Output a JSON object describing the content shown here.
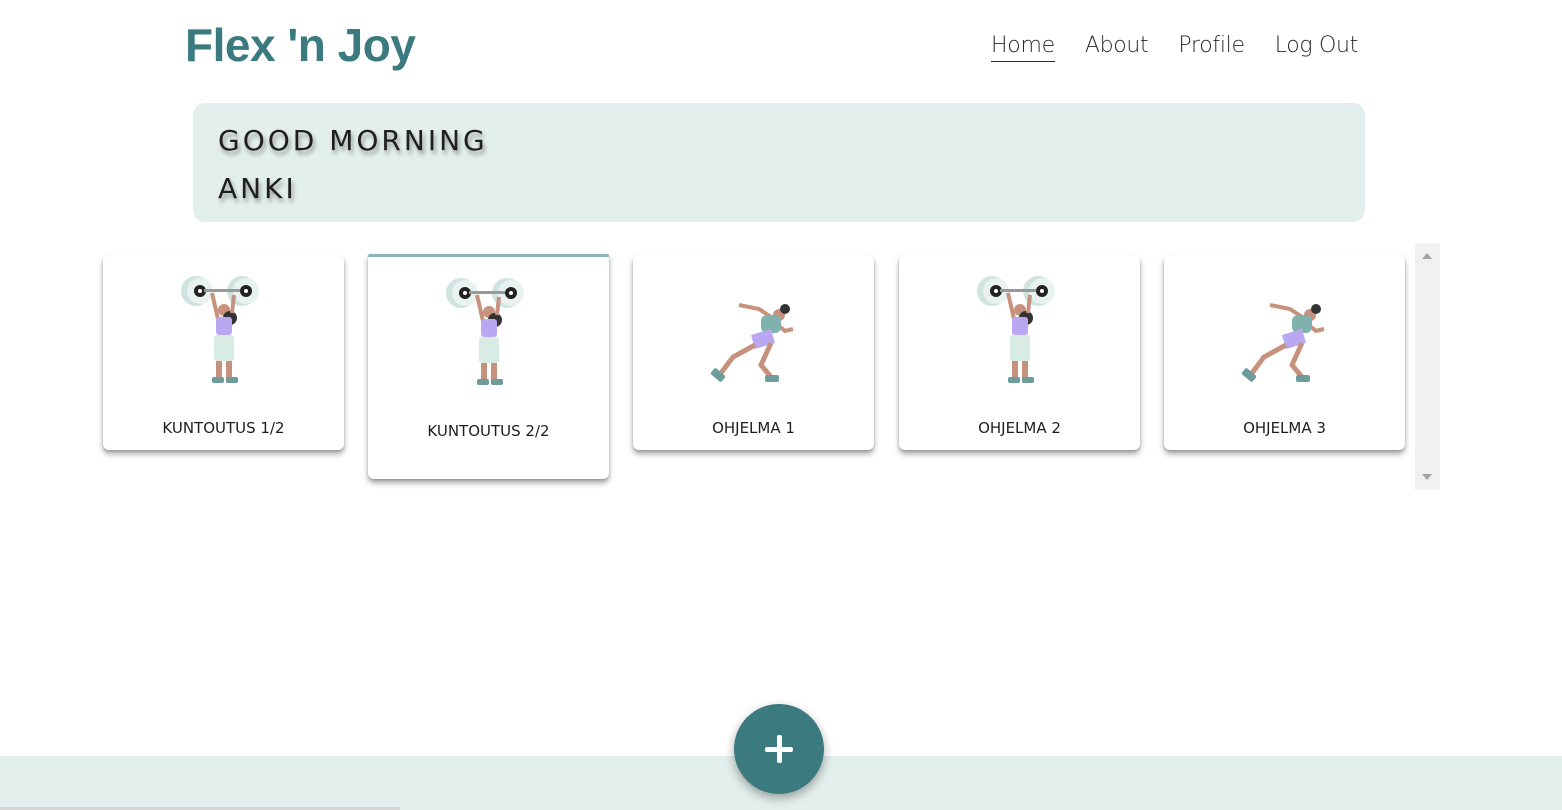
{
  "brand": {
    "title": "Flex 'n Joy"
  },
  "nav": {
    "items": [
      {
        "label": "Home",
        "active": true
      },
      {
        "label": "About",
        "active": false
      },
      {
        "label": "Profile",
        "active": false
      },
      {
        "label": "Log Out",
        "active": false
      }
    ]
  },
  "greeting": {
    "line1": "GOOD MORNING",
    "line2": "ANKI"
  },
  "cards": [
    {
      "label": "KUNTOUTUS 1/2",
      "icon": "weightlifter-icon"
    },
    {
      "label": "KUNTOUTUS 2/2",
      "icon": "weightlifter-icon",
      "selected": true
    },
    {
      "label": "OHJELMA 1",
      "icon": "runner-icon"
    },
    {
      "label": "OHJELMA 2",
      "icon": "weightlifter-icon"
    },
    {
      "label": "OHJELMA 3",
      "icon": "runner-icon"
    }
  ],
  "fab": {
    "icon": "plus-icon"
  },
  "colors": {
    "brand": "#3b7a7e",
    "panel": "#e3efec",
    "selected_border": "#8fb4b8"
  }
}
